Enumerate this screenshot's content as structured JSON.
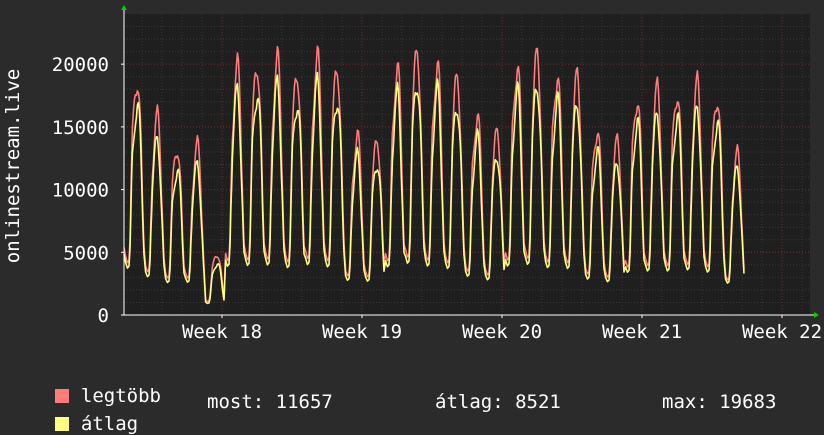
{
  "chart_data": {
    "type": "line",
    "ylabel": "onlinestream.live",
    "ylim": [
      0,
      24000
    ],
    "yticks": [
      0,
      5000,
      10000,
      15000,
      20000
    ],
    "xlim": [
      17.3,
      22.2
    ],
    "xticks": [
      {
        "value": 18,
        "label": "Week 18"
      },
      {
        "value": 19,
        "label": "Week 19"
      },
      {
        "value": 20,
        "label": "Week 20"
      },
      {
        "value": 21,
        "label": "Week 21"
      },
      {
        "value": 22,
        "label": "Week 22"
      }
    ],
    "grid": true,
    "days_start_week": 17.3,
    "series": [
      {
        "name": "legtöbb",
        "color": "#ff7c7c",
        "daily_peaks": [
          19000,
          15800,
          13500,
          13500,
          4900,
          19800,
          20100,
          20400,
          19400,
          20600,
          19800,
          14300,
          14000,
          19700,
          21100,
          20000,
          19000,
          16000,
          14600,
          20000,
          20700,
          19300,
          19000,
          15000,
          13800,
          17500,
          18000,
          18000,
          18400,
          17600,
          12800
        ]
      },
      {
        "name": "átlag",
        "color": "#ffff80",
        "daily_peaks": [
          17000,
          13900,
          11800,
          11900,
          4200,
          17700,
          18000,
          18200,
          17200,
          18300,
          17500,
          12600,
          12300,
          17500,
          18800,
          17800,
          16900,
          14100,
          12800,
          17800,
          18400,
          17200,
          16900,
          13100,
          12100,
          15500,
          16000,
          16000,
          16400,
          15600,
          11600
        ]
      }
    ]
  },
  "legend": {
    "max_label": "legtöbb",
    "avg_label": "átlag"
  },
  "stats": {
    "now": "most: 11657",
    "avg": "átlag: 8521",
    "max": "max: 19683"
  },
  "colors": {
    "background": "#2b2b2b",
    "plot_background": "#1f1f1f",
    "grid_minor": "#3a3a3a",
    "grid_major": "#7a2a2a",
    "axis": "#ffffff",
    "arrow": "#00d000"
  }
}
